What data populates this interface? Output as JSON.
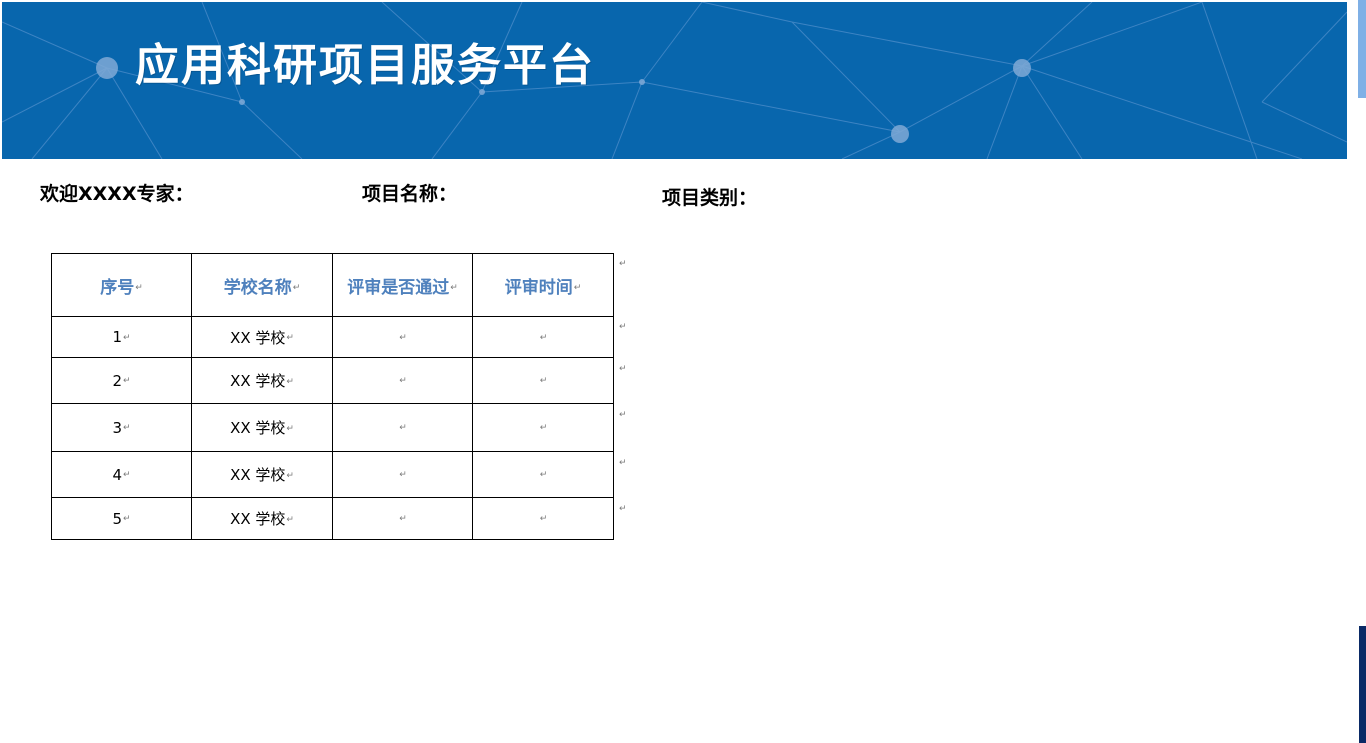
{
  "banner": {
    "title": "应用科研项目服务平台"
  },
  "info": {
    "welcome": "欢迎XXXX专家：",
    "project_name_label": "项目名称：",
    "project_type_label": "项目类别："
  },
  "table": {
    "headers": [
      "序号",
      "学校名称",
      "评审是否通过",
      "评审时间"
    ],
    "rows": [
      {
        "index": "1",
        "school": "XX 学校",
        "passed": "",
        "time": ""
      },
      {
        "index": "2",
        "school": "XX 学校",
        "passed": "",
        "time": ""
      },
      {
        "index": "3",
        "school": "XX 学校",
        "passed": "",
        "time": ""
      },
      {
        "index": "4",
        "school": "XX 学校",
        "passed": "",
        "time": ""
      },
      {
        "index": "5",
        "school": "XX 学校",
        "passed": "",
        "time": ""
      }
    ],
    "paragraph_mark": "↵"
  },
  "colors": {
    "banner_bg": "#0866ad",
    "header_text": "#4f81bd",
    "edge_light": "#7fb0e6",
    "edge_dark": "#0a2a66"
  }
}
